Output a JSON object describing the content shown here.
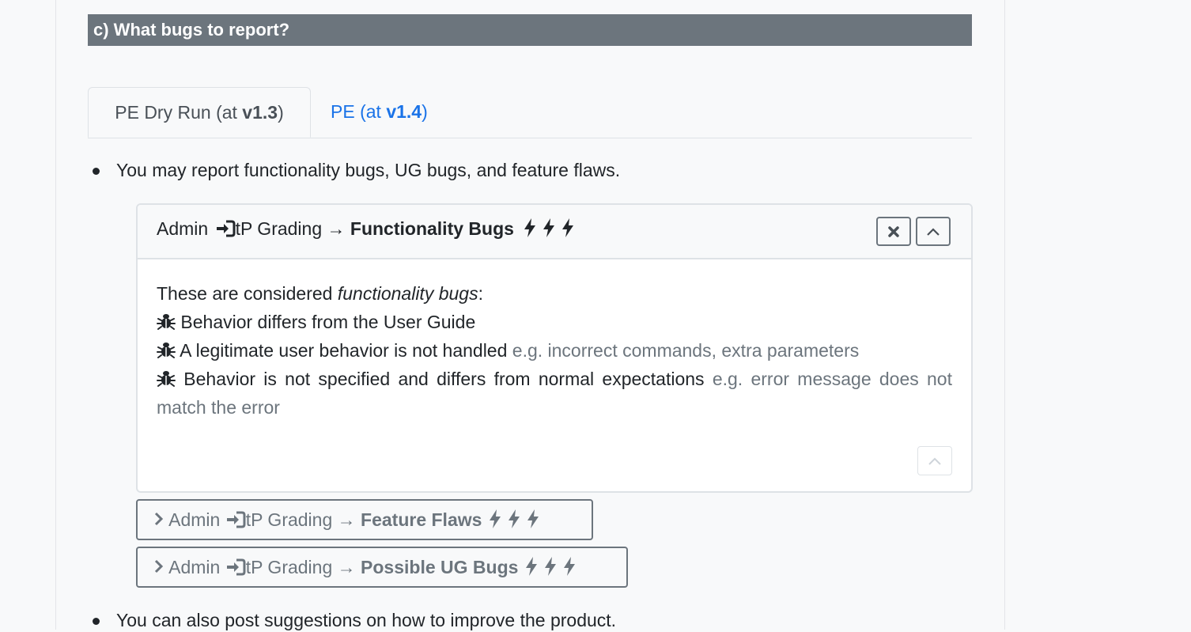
{
  "section": {
    "header": "c) What bugs to report?"
  },
  "tabs": [
    {
      "prefix": "PE Dry Run (at ",
      "version": "v1.3",
      "suffix": ")",
      "active": true
    },
    {
      "prefix": "PE (at ",
      "version": "v1.4",
      "suffix": ")",
      "active": false
    }
  ],
  "bullets": [
    "You may report functionality bugs, UG bugs, and feature flaws.",
    "You can also post suggestions on how to improve the product."
  ],
  "panel": {
    "breadcrumb_admin": "Admin",
    "breadcrumb_grading": "tP Grading",
    "arrow": "→",
    "title": "Functionality Bugs",
    "body_intro_prefix": "These are considered ",
    "body_intro_em": "functionality bugs",
    "body_intro_suffix": ":",
    "items": [
      {
        "text": "Behavior differs from the User Guide",
        "eg": ""
      },
      {
        "text": "A legitimate user behavior is not handled",
        "eg": "e.g. incorrect commands, extra parameters"
      },
      {
        "text": "Behavior is not specified and differs from normal expectations",
        "eg": "e.g. error message does not match the error"
      }
    ]
  },
  "collapsed_panels": [
    {
      "admin": "Admin",
      "grading": "tP Grading",
      "arrow": "→",
      "title": "Feature Flaws"
    },
    {
      "admin": "Admin",
      "grading": "tP Grading",
      "arrow": "→",
      "title": "Possible UG Bugs"
    }
  ],
  "icons": {
    "login": "sign-in-icon",
    "bolt": "bolt-icon",
    "bug": "bug-icon",
    "close": "close-icon",
    "collapse": "chevron-up-icon",
    "expand": "chevron-right-icon"
  },
  "colors": {
    "header_bg": "#6c757d",
    "link": "#1a73e8",
    "muted": "#6c757d"
  }
}
